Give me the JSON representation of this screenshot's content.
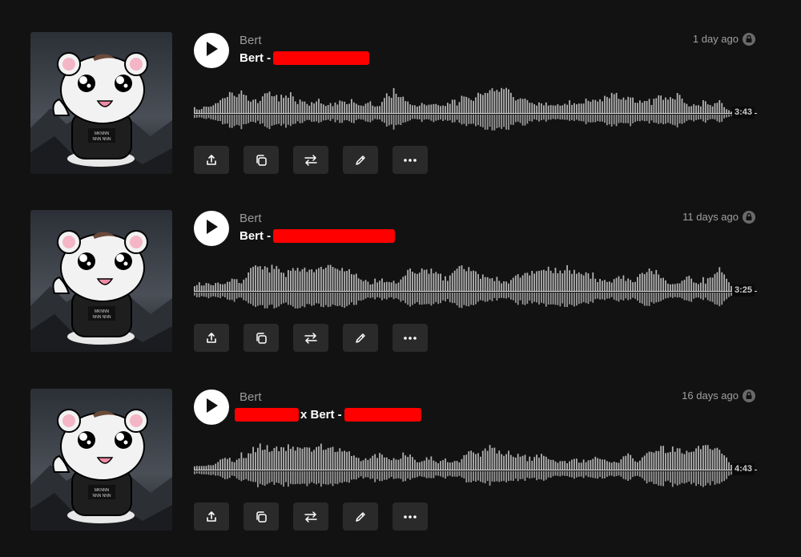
{
  "tracks": [
    {
      "artist": "Bert",
      "title_prefix": "",
      "title_main": "Bert -",
      "redact_prefix": false,
      "age": "1 day ago",
      "duration": "3:43",
      "seed": 11
    },
    {
      "artist": "Bert",
      "title_prefix": "",
      "title_main": "Bert -",
      "redact_prefix": false,
      "age": "11 days ago",
      "duration": "3:25",
      "seed": 29
    },
    {
      "artist": "Bert",
      "title_prefix": "",
      "title_main": "x Bert -",
      "redact_prefix": true,
      "age": "16 days ago",
      "duration": "4:43",
      "seed": 53
    }
  ],
  "actions": [
    {
      "name": "share-button",
      "icon": "share-icon"
    },
    {
      "name": "copy-button",
      "icon": "copy-icon"
    },
    {
      "name": "swap-button",
      "icon": "swap-icon"
    },
    {
      "name": "edit-button",
      "icon": "pencil-icon"
    },
    {
      "name": "more-button",
      "icon": "more-icon"
    }
  ],
  "colors": {
    "background": "#121212",
    "wave": "#b5b5b5",
    "button": "#2a2a2a",
    "redaction": "#ff0000"
  }
}
